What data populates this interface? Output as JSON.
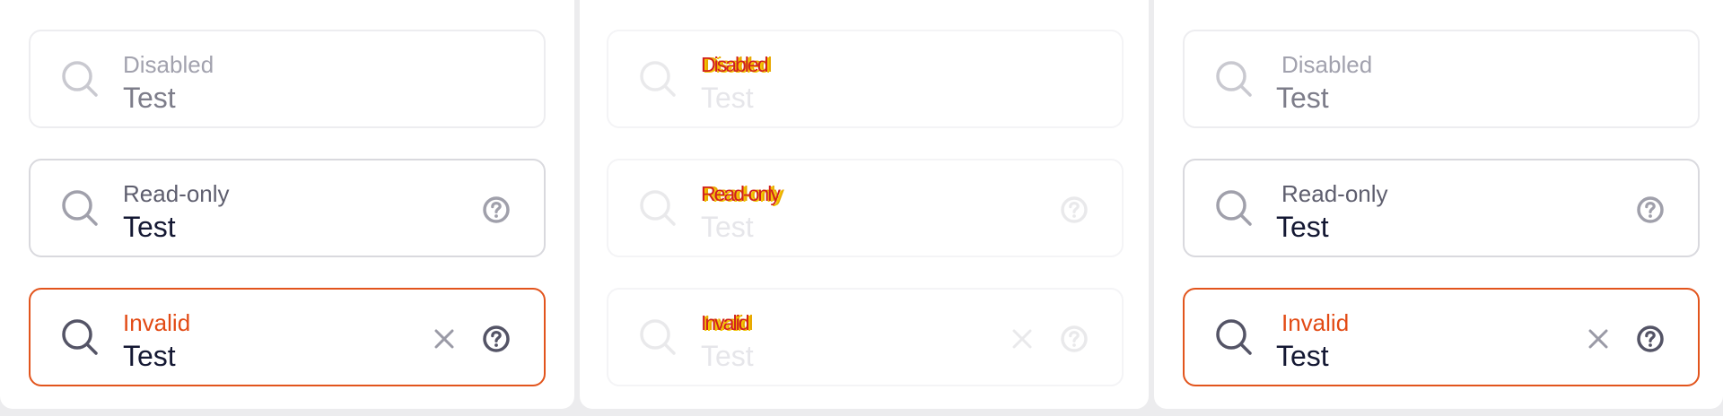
{
  "colors": {
    "border_default": "#d4d4da",
    "border_invalid": "#e2541c",
    "label_invalid": "#e24a14",
    "text_primary": "#141833",
    "icon_muted": "#a0a0ab",
    "icon_dark": "#545466"
  },
  "icons": {
    "search": "search-icon",
    "help": "help-circle-icon",
    "clear": "close-icon"
  },
  "panels": [
    {
      "disabled": {
        "label": "Disabled",
        "value": "Test"
      },
      "readonly": {
        "label": "Read-only",
        "value": "Test"
      },
      "invalid": {
        "label": "Invalid",
        "value": "Test"
      }
    },
    {
      "disabled": {
        "label": "Disabled",
        "value": "Test"
      },
      "readonly": {
        "label": "Read-only",
        "value": "Test"
      },
      "invalid": {
        "label": "Invalid",
        "value": "Test"
      }
    },
    {
      "disabled": {
        "label": "Disabled",
        "value": "Test"
      },
      "readonly": {
        "label": "Read-only",
        "value": "Test"
      },
      "invalid": {
        "label": "Invalid",
        "value": "Test"
      }
    }
  ]
}
